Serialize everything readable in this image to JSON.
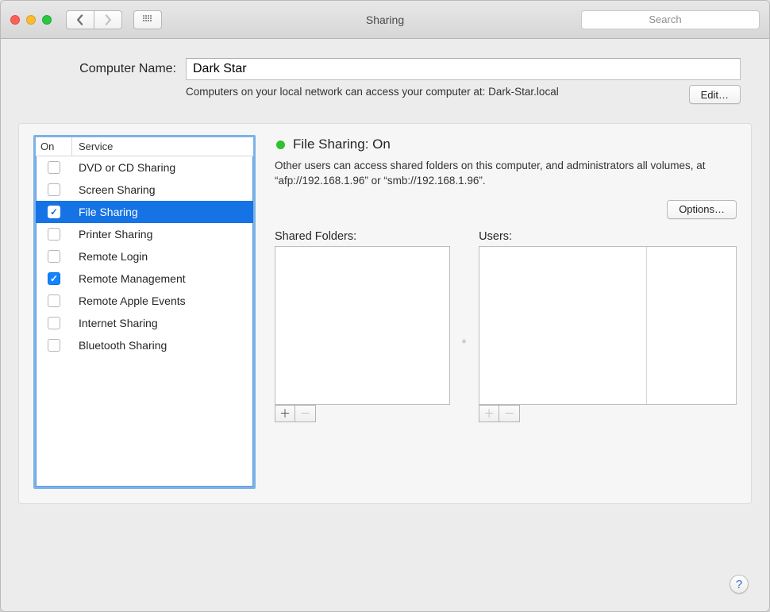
{
  "window": {
    "title": "Sharing"
  },
  "toolbar": {
    "search_placeholder": "Search"
  },
  "computer_name": {
    "label": "Computer Name:",
    "value": "Dark Star",
    "hint": "Computers on your local network can access your computer at: Dark-Star.local",
    "edit_label": "Edit…"
  },
  "services": {
    "header_on": "On",
    "header_service": "Service",
    "items": [
      {
        "label": "DVD or CD Sharing",
        "on": false,
        "selected": false
      },
      {
        "label": "Screen Sharing",
        "on": false,
        "selected": false
      },
      {
        "label": "File Sharing",
        "on": true,
        "selected": true
      },
      {
        "label": "Printer Sharing",
        "on": false,
        "selected": false
      },
      {
        "label": "Remote Login",
        "on": false,
        "selected": false
      },
      {
        "label": "Remote Management",
        "on": true,
        "selected": false
      },
      {
        "label": "Remote Apple Events",
        "on": false,
        "selected": false
      },
      {
        "label": "Internet Sharing",
        "on": false,
        "selected": false
      },
      {
        "label": "Bluetooth Sharing",
        "on": false,
        "selected": false
      }
    ]
  },
  "detail": {
    "status_label": "File Sharing: On",
    "status_color": "#30c030",
    "description": "Other users can access shared folders on this computer, and administrators all volumes, at “afp://192.168.1.96” or “smb://192.168.1.96”.",
    "options_label": "Options…",
    "shared_folders_label": "Shared Folders:",
    "users_label": "Users:"
  },
  "help": {
    "glyph": "?"
  }
}
